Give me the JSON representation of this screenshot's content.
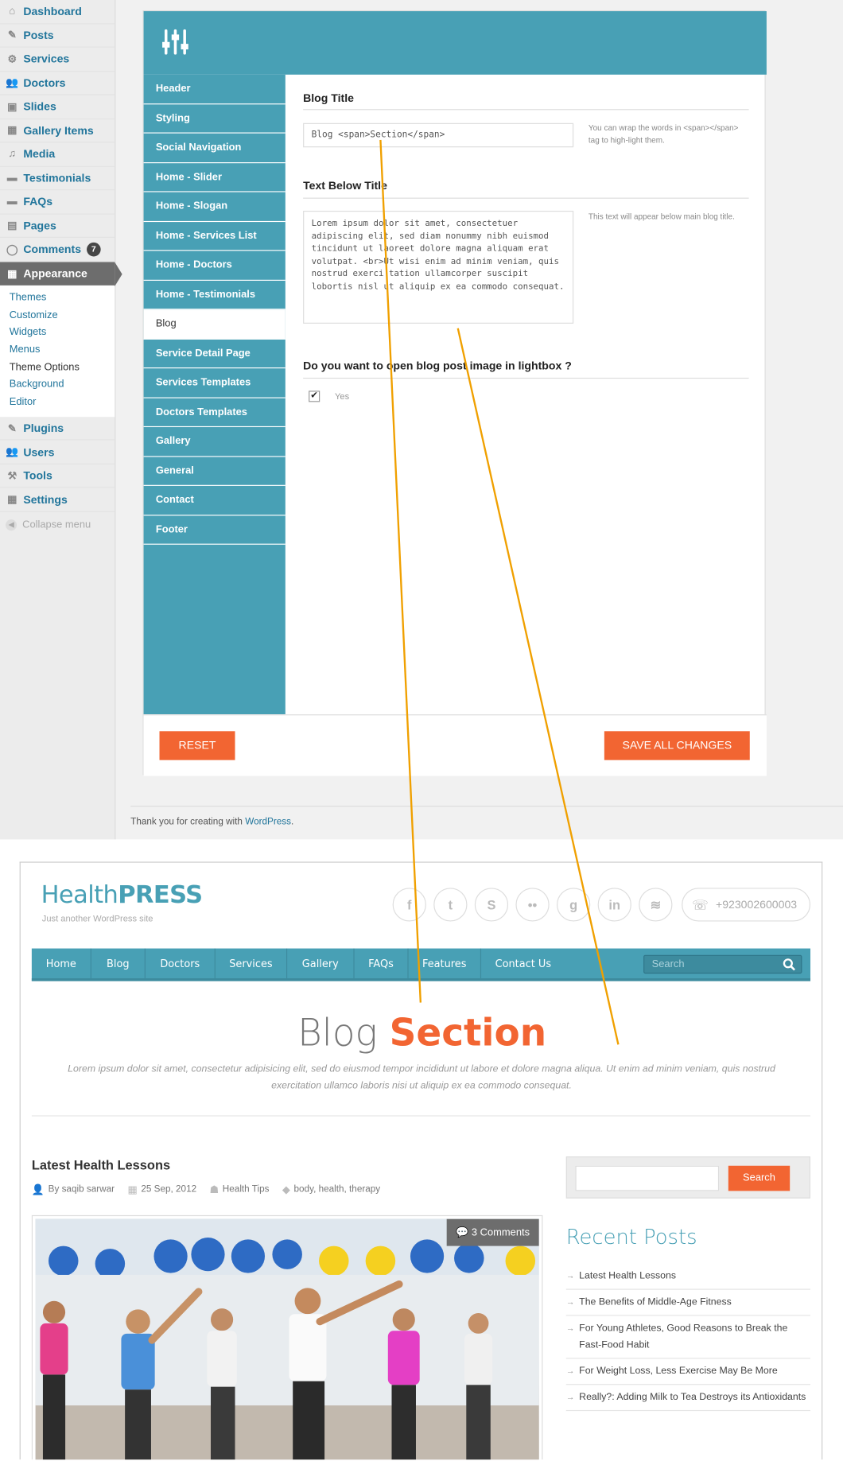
{
  "admin_menu": {
    "items_top": [
      {
        "label": "Dashboard",
        "icon": "dashboard-icon"
      },
      {
        "label": "Posts",
        "icon": "pin-icon"
      },
      {
        "label": "Services",
        "icon": "gear-icon"
      },
      {
        "label": "Doctors",
        "icon": "users-icon"
      },
      {
        "label": "Slides",
        "icon": "image-icon"
      },
      {
        "label": "Gallery Items",
        "icon": "grid-icon"
      },
      {
        "label": "Media",
        "icon": "media-icon"
      },
      {
        "label": "Testimonials",
        "icon": "comment-icon"
      },
      {
        "label": "FAQs",
        "icon": "comment-icon"
      },
      {
        "label": "Pages",
        "icon": "page-icon"
      },
      {
        "label": "Comments",
        "icon": "bubble-icon",
        "badge": "7"
      }
    ],
    "appearance": {
      "label": "Appearance",
      "icon": "appearance-icon"
    },
    "submenu": [
      "Themes",
      "Customize",
      "Widgets",
      "Menus",
      "Theme Options",
      "Background",
      "Editor"
    ],
    "submenu_current": "Theme Options",
    "items_bottom": [
      {
        "label": "Plugins",
        "icon": "plugin-icon"
      },
      {
        "label": "Users",
        "icon": "users-icon"
      },
      {
        "label": "Tools",
        "icon": "tools-icon"
      },
      {
        "label": "Settings",
        "icon": "settings-icon"
      }
    ],
    "collapse_label": "Collapse menu"
  },
  "options_panel": {
    "sidebar": [
      "Header",
      "Styling",
      "Social Navigation",
      "Home - Slider",
      "Home - Slogan",
      "Home - Services List",
      "Home - Doctors",
      "Home - Testimonials",
      "Blog",
      "Service Detail Page",
      "Services Templates",
      "Doctors Templates",
      "Gallery",
      "General",
      "Contact",
      "Footer"
    ],
    "selected": "Blog",
    "blog_title_label": "Blog Title",
    "blog_title_value": "Blog <span>Section</span>",
    "blog_title_hint": "You can wrap the words in <span></span> tag to high-light them.",
    "text_below_label": "Text Below Title",
    "text_below_value": "Lorem ipsum dolor sit amet, consectetuer adipiscing elit, sed diam nonummy nibh euismod tincidunt ut laoreet dolore magna aliquam erat volutpat. <br>Ut wisi enim ad minim veniam, quis nostrud exerci tation ullamcorper suscipit lobortis nisl ut aliquip ex ea commodo consequat.",
    "text_below_hint": "This text will appear below main blog title.",
    "lightbox_label": "Do you want to open blog post image in lightbox ?",
    "lightbox_option": "Yes",
    "lightbox_checked": true,
    "reset_label": "RESET",
    "save_label": "SAVE ALL CHANGES"
  },
  "footer_admin": {
    "thanks": "Thank you for creating with ",
    "link": "WordPress",
    "end": "."
  },
  "site": {
    "logo_light": "Health",
    "logo_bold": "PRESS",
    "tagline": "Just another WordPress site",
    "social": [
      {
        "glyph": "f",
        "icon": "facebook-icon"
      },
      {
        "glyph": "t",
        "icon": "twitter-icon"
      },
      {
        "glyph": "S",
        "icon": "skype-icon"
      },
      {
        "glyph": "••",
        "icon": "flickr-icon"
      },
      {
        "glyph": "g",
        "icon": "google-icon"
      },
      {
        "glyph": "in",
        "icon": "linkedin-icon"
      },
      {
        "glyph": "≋",
        "icon": "rss-icon"
      }
    ],
    "phone": "+923002600003",
    "nav": [
      "Home",
      "Blog",
      "Doctors",
      "Services",
      "Gallery",
      "FAQs",
      "Features",
      "Contact Us"
    ],
    "search_placeholder": "Search",
    "page_title_light": "Blog ",
    "page_title_bold": "Section",
    "page_desc": "Lorem ipsum dolor sit amet, consectetur adipisicing elit, sed do eiusmod tempor incididunt ut labore et dolore magna aliqua. Ut enim ad minim veniam, quis nostrud exercitation ullamco laboris nisi ut aliquip ex ea commodo consequat.",
    "post_title": "Latest Health Lessons",
    "post_author": "By saqib sarwar",
    "post_date": "25 Sep, 2012",
    "post_category": "Health Tips",
    "post_tags": "body, health, therapy",
    "post_comments": "3 Comments",
    "sidebar_search_button": "Search",
    "recent_posts_title": "Recent Posts",
    "recent_posts": [
      "Latest Health Lessons",
      "The Benefits of Middle-Age Fitness",
      "For Young Athletes, Good Reasons to Break the Fast-Food Habit",
      "For Weight Loss, Less Exercise May Be More",
      "Really?: Adding Milk to Tea Destroys its Antioxidants"
    ]
  },
  "colors": {
    "accent_teal": "#48a0b5",
    "accent_orange": "#f26532",
    "annotation_line": "#f0a000"
  }
}
